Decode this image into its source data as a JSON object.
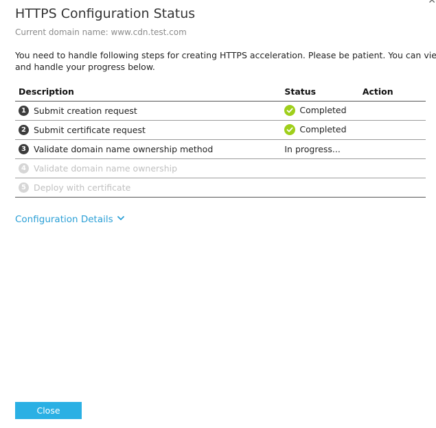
{
  "dialog": {
    "title": "HTTPS Configuration Status",
    "domain_line": "Current domain name: www.cdn.test.com",
    "intro": "You need to handle following steps for creating HTTPS acceleration. Please be patient. You can view and handle your progress below.",
    "close_icon": "close-icon"
  },
  "table": {
    "headers": {
      "description": "Description",
      "status": "Status",
      "action": "Action"
    },
    "rows": [
      {
        "num": "1",
        "description": "Submit creation request",
        "status": "Completed",
        "state": "completed"
      },
      {
        "num": "2",
        "description": "Submit certificate request",
        "status": "Completed",
        "state": "completed"
      },
      {
        "num": "3",
        "description": "Validate domain name ownership method",
        "status": "In progress...",
        "state": "in-progress"
      },
      {
        "num": "4",
        "description": "Validate domain name ownership",
        "status": "",
        "state": "pending"
      },
      {
        "num": "5",
        "description": "Deploy with certificate",
        "status": "",
        "state": "pending"
      }
    ]
  },
  "details_link": {
    "label": "Configuration Details",
    "icon": "chevron-down-icon"
  },
  "footer": {
    "close_label": "Close"
  },
  "colors": {
    "accent": "#2ab0e4",
    "link": "#2a9fd6",
    "success": "#9fcf1b",
    "step_active": "#3c3c3c",
    "step_disabled": "#d6d6d6"
  }
}
